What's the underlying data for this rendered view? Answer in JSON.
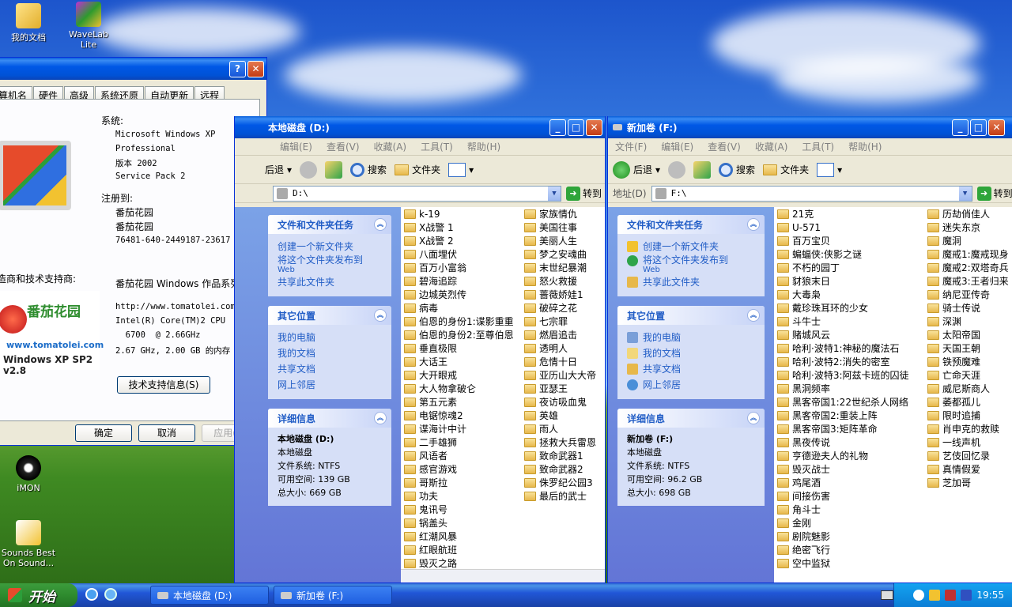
{
  "desktop": {
    "icons": [
      {
        "name": "my-documents-desktop-icon",
        "label": "我的文档"
      },
      {
        "name": "wavelab-desktop-icon",
        "label": "WaveLab Lite"
      },
      {
        "name": "imon-desktop-icon",
        "label": "iMON"
      },
      {
        "name": "sounds-best-desktop-icon",
        "label": "Sounds Best On Sound..."
      }
    ]
  },
  "sysprops": {
    "tabs": [
      "算机名",
      "硬件",
      "高级",
      "系统还原",
      "自动更新",
      "远程"
    ],
    "system_heading": "系统:",
    "system_lines": [
      "Microsoft Windows XP",
      "Professional",
      "版本 2002",
      "Service Pack 2"
    ],
    "registered_heading": "注册到:",
    "registered_lines": [
      "番茄花园",
      "番茄花园",
      "76481-640-2449187-23617"
    ],
    "manufacturer_heading": "造商和技术支持商:",
    "manufacturer_lines": [
      "番茄花园 Windows 作品系列",
      "",
      "http://www.tomatolei.com",
      "Intel(R) Core(TM)2 CPU",
      "  6700  @ 2.66GHz",
      "2.67 GHz, 2.00 GB 的内存"
    ],
    "logo_title": "番茄花园",
    "logo_url": "www.tomatolei.com",
    "logo_caption": "Windows XP SP2 v2.8",
    "support_button": "技术支持信息(S)",
    "ok": "确定",
    "cancel": "取消",
    "apply": "应用(A)"
  },
  "winD": {
    "title": "本地磁盘 (D:)",
    "menu": [
      "编辑(E)",
      "查看(V)",
      "收藏(A)",
      "工具(T)",
      "帮助(H)"
    ],
    "back": "后退",
    "search": "搜索",
    "folders": "文件夹",
    "address": "D:\\",
    "go": "转到",
    "tasks_title": "文件和文件夹任务",
    "tasks": [
      "创建一个新文件夹",
      "将这个文件夹发布到",
      "Web",
      "共享此文件夹"
    ],
    "places_title": "其它位置",
    "places": [
      "我的电脑",
      "我的文档",
      "共享文档",
      "网上邻居"
    ],
    "details_title": "详细信息",
    "details": [
      "本地磁盘 (D:)",
      "本地磁盘",
      "文件系统: NTFS",
      "可用空间: 139 GB",
      "总大小: 669 GB"
    ],
    "col1": [
      "k-19",
      "X战警 1",
      "X战警 2",
      "八面埋伏",
      "百万小富翁",
      "碧海追踪",
      "边城英烈传",
      "病毒",
      "伯恩的身份1:谍影重重",
      "伯恩的身份2:至尊伯恩",
      "垂直极限",
      "大话王",
      "大开眼戒",
      "大人物拿破仑",
      "第五元素",
      "电锯惊魂2",
      "谍海计中计",
      "二手雄狮",
      "风语者",
      "感官游戏",
      "哥斯拉",
      "功夫",
      "鬼讯号",
      "锅盖头",
      "红潮风暴",
      "红眼航班",
      "毁灭之路"
    ],
    "col2": [
      "家族情仇",
      "美国往事",
      "美丽人生",
      "梦之安魂曲",
      "末世纪暴潮",
      "怒火救援",
      "蔷薇娇娃1",
      "破碎之花",
      "七宗罪",
      "燃眉追击",
      "透明人",
      "危情十日",
      "亚历山大大帝",
      "亚瑟王",
      "夜访吸血鬼",
      "英雄",
      "雨人",
      "拯救大兵雷恩",
      "致命武器1",
      "致命武器2",
      "侏罗纪公园3",
      "最后的武士"
    ]
  },
  "winF": {
    "title": "新加卷 (F:)",
    "menu": [
      "文件(F)",
      "编辑(E)",
      "查看(V)",
      "收藏(A)",
      "工具(T)",
      "帮助(H)"
    ],
    "back": "后退",
    "search": "搜索",
    "folders": "文件夹",
    "address_label": "地址(D)",
    "address": "F:\\",
    "go": "转到",
    "tasks_title": "文件和文件夹任务",
    "tasks": [
      "创建一个新文件夹",
      "将这个文件夹发布到",
      "Web",
      "共享此文件夹"
    ],
    "places_title": "其它位置",
    "places": [
      "我的电脑",
      "我的文档",
      "共享文档",
      "网上邻居"
    ],
    "details_title": "详细信息",
    "details": [
      "新加卷 (F:)",
      "本地磁盘",
      "文件系统: NTFS",
      "可用空间: 96.2 GB",
      "总大小: 698 GB"
    ],
    "col1": [
      "21克",
      "U-571",
      "百万宝贝",
      "蝙蝠侠:侠影之谜",
      "不朽的园丁",
      "豺狼末日",
      "大毒枭",
      "戴珍珠耳环的少女",
      "斗牛士",
      "赌城风云",
      "哈利·波特1:神秘的魔法石",
      "哈利·波特2:消失的密室",
      "哈利·波特3:阿兹卡班的囚徒",
      "黑洞频率",
      "黑客帝国1:22世纪杀人网络",
      "黑客帝国2:重装上阵",
      "黑客帝国3:矩阵革命",
      "黑夜传说",
      "亨德逊夫人的礼物",
      "毁灭战士",
      "鸡尾酒",
      "间接伤害",
      "角斗士",
      "金刚",
      "剧院魅影",
      "绝密飞行",
      "空中监狱"
    ],
    "col2": [
      "历劫俏佳人",
      "迷失东京",
      "魔洞",
      "魔戒1:魔戒现身",
      "魔戒2:双塔奇兵",
      "魔戒3:王者归来",
      "纳尼亚传奇",
      "骑士传说",
      "深渊",
      "太阳帝国",
      "天国王朝",
      "铁预魔难",
      "亡命天涯",
      "威尼斯商人",
      "萎都孤儿",
      "限时追捕",
      "肖申克的救赎",
      "一线声机",
      "艺伎回忆录",
      "真情假爱",
      "芝加哥"
    ]
  },
  "taskbar": {
    "start": "开始",
    "tasks": [
      "本地磁盘 (D:)",
      "新加卷 (F:)"
    ],
    "clock": "19:55"
  }
}
